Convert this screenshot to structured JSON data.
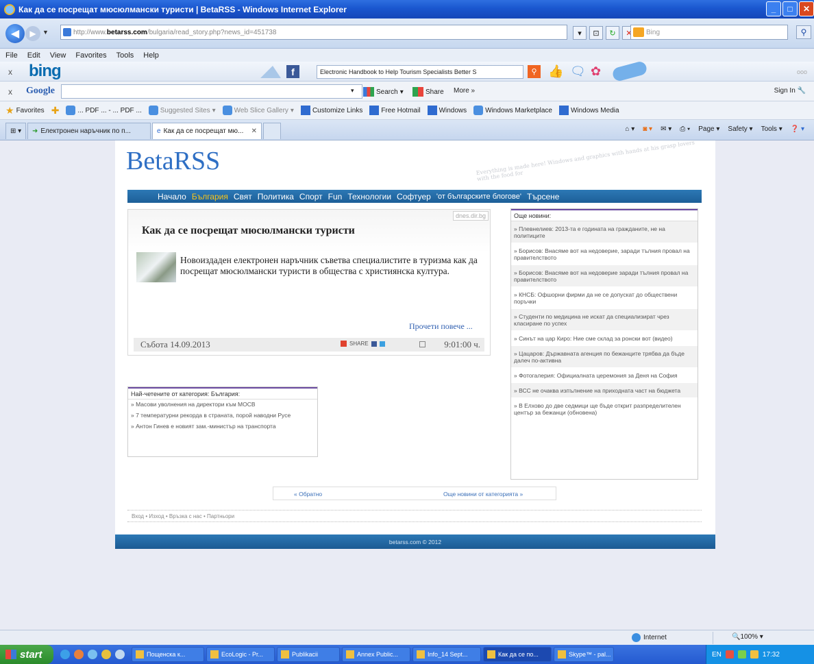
{
  "window": {
    "title": "Как да се посрещат мюсюлмански туристи | BetaRSS - Windows Internet Explorer"
  },
  "address": {
    "url_prefix": "http://www.",
    "url_domain": "betarss.com",
    "url_path": "/bulgaria/read_story.php?news_id=451738",
    "search_placeholder": "Bing"
  },
  "menu": [
    "File",
    "Edit",
    "View",
    "Favorites",
    "Tools",
    "Help"
  ],
  "bing_toolbar": {
    "logo": "bing",
    "search_value": "Electronic Handbook to Help Tourism Specialists Better S",
    "dots": "ooo"
  },
  "google_toolbar": {
    "logo": "Google",
    "search_label": "Search",
    "share_label": "Share",
    "more_label": "More »",
    "signin_label": "Sign In"
  },
  "favorites": {
    "label": "Favorites",
    "items": [
      {
        "label": "... PDF ... - ... PDF ...",
        "gray": false
      },
      {
        "label": "Suggested Sites",
        "gray": true
      },
      {
        "label": "Web Slice Gallery",
        "gray": true
      },
      {
        "label": "Customize Links",
        "gray": false
      },
      {
        "label": "Free Hotmail",
        "gray": false
      },
      {
        "label": "Windows",
        "gray": false
      },
      {
        "label": "Windows Marketplace",
        "gray": false
      },
      {
        "label": "Windows Media",
        "gray": false
      }
    ]
  },
  "tabs": [
    {
      "label": "Електронен наръчник по п..."
    },
    {
      "label": "Как да се посрещат мю..."
    }
  ],
  "commandbar": {
    "page": "Page",
    "safety": "Safety",
    "tools": "Tools"
  },
  "site": {
    "brand": "BetaRSS",
    "deco_text": "Everything is made here! Windows and graphics with hands at his grasp lovers with the food for",
    "nav": [
      {
        "label": "Начало",
        "active": false
      },
      {
        "label": "България",
        "active": true
      },
      {
        "label": "Свят",
        "active": false
      },
      {
        "label": "Политика",
        "active": false
      },
      {
        "label": "Спорт",
        "active": false
      },
      {
        "label": "Fun",
        "active": false
      },
      {
        "label": "Технологии",
        "active": false
      },
      {
        "label": "Софтуер",
        "active": false
      },
      {
        "label": "'от българските блогове'",
        "active": false
      },
      {
        "label": "Търсене",
        "active": false
      }
    ],
    "article": {
      "source": "dnes.dir.bg",
      "title": "Как да се посрещат мюсюлмански туристи",
      "lead": "Новоиздаден електронен наръчник съветва специалистите в туризма как да посрещат мюсюлмански туристи в общества с християнска култура.",
      "read_more": "Прочети повече ...",
      "date": "Събота 14.09.2013",
      "share_label": "SHARE",
      "time": "9:01:00 ч."
    },
    "category_box": {
      "heading": "Най-четените от категория: България:",
      "items": [
        "» Масови уволнения на директори към МОСВ",
        "» 7 температурни рекорда в страната, порой наводни Русе",
        "» Антон Гинев е новият зам.-министър на транспорта"
      ]
    },
    "sidebar": {
      "heading": "Още новини:",
      "items": [
        "» Плевнелиев: 2013-та е годината на гражданите, не на политиците",
        "» Борисов: Внасяме вот на недоверие, заради тълния провал на правителството",
        "» Борисов: Внасяме вот на недоверие заради тълния провал на правителството",
        "» КНСБ: Офшорни фирми да не се допускат до обществени поръчки",
        "» Студенти по медицина не искат да специализират чрез класиране по успех",
        "» Синът на цар Киро: Ние сме склад за ронски вот (видео)",
        "» Цацаров: Държавната агенция по бежанците трябва да бъде далеч по-активна",
        "» Фотогалерия: Официалната церемония за Деня на София",
        "» ВСС не очаква изпълнение на приходната част на бюджета",
        "» В Елхово до две седмици ще бъде открит разпределителен център за бежанци (обновена)"
      ]
    },
    "pager": {
      "back": "« Обратно",
      "forward": "Още новини от категорията »"
    },
    "footer_links": "Вход • Изход • Връзка с нас • Партньори",
    "copyright": "betarss.com © 2012"
  },
  "statusbar": {
    "zone": "Internet",
    "zoom": "100%"
  },
  "taskbar": {
    "start": "start",
    "tasks": [
      {
        "label": "Пощенска к..."
      },
      {
        "label": "EcoLogic - Pr..."
      },
      {
        "label": "Publikacii"
      },
      {
        "label": "Annex Public..."
      },
      {
        "label": "Info_14 Sept..."
      },
      {
        "label": "Как да се по..."
      },
      {
        "label": "Skype™ - pal..."
      }
    ],
    "lang": "EN",
    "clock": "17:32"
  }
}
